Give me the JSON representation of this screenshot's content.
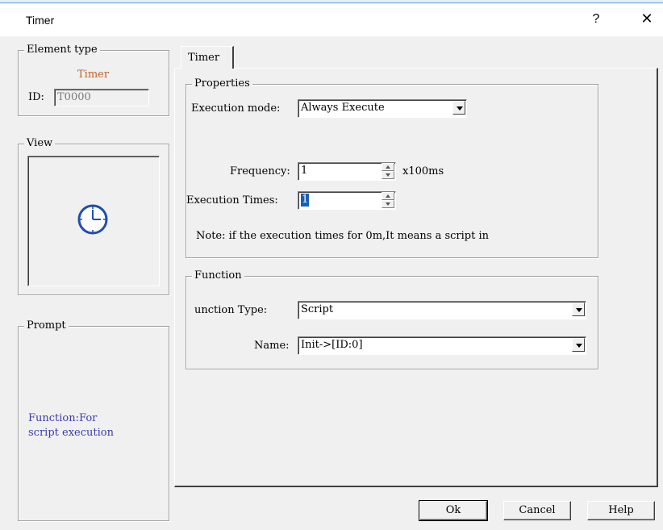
{
  "window": {
    "title": "Timer",
    "help": "?",
    "close": "✕"
  },
  "element_type": {
    "group_label": "Element type",
    "type_value": "Timer",
    "id_label": "ID:",
    "id_value": "T0000",
    "type_color": "#c0612b"
  },
  "view": {
    "group_label": "View",
    "icon": "clock-icon",
    "icon_color": "#1f4fa8"
  },
  "prompt": {
    "group_label": "Prompt",
    "text_line1": "Function:For",
    "text_line2": "script execution",
    "text_color": "#3b3bb0"
  },
  "tab": {
    "label": "Timer"
  },
  "properties": {
    "group_label": "Properties",
    "execution_mode_label": "Execution mode:",
    "execution_mode_value": "Always Execute",
    "frequency_label": "Frequency:",
    "frequency_value": "1",
    "frequency_unit": "x100ms",
    "execution_times_label": "Execution Times:",
    "execution_times_value": "1",
    "note": "Note: if the execution times for 0m,It means a script in"
  },
  "function": {
    "group_label": "Function",
    "type_label": "unction Type:",
    "type_value": "Script",
    "name_label": "Name:",
    "name_value": "Init->[ID:0]"
  },
  "buttons": {
    "ok": "Ok",
    "cancel": "Cancel",
    "help": "Help"
  }
}
